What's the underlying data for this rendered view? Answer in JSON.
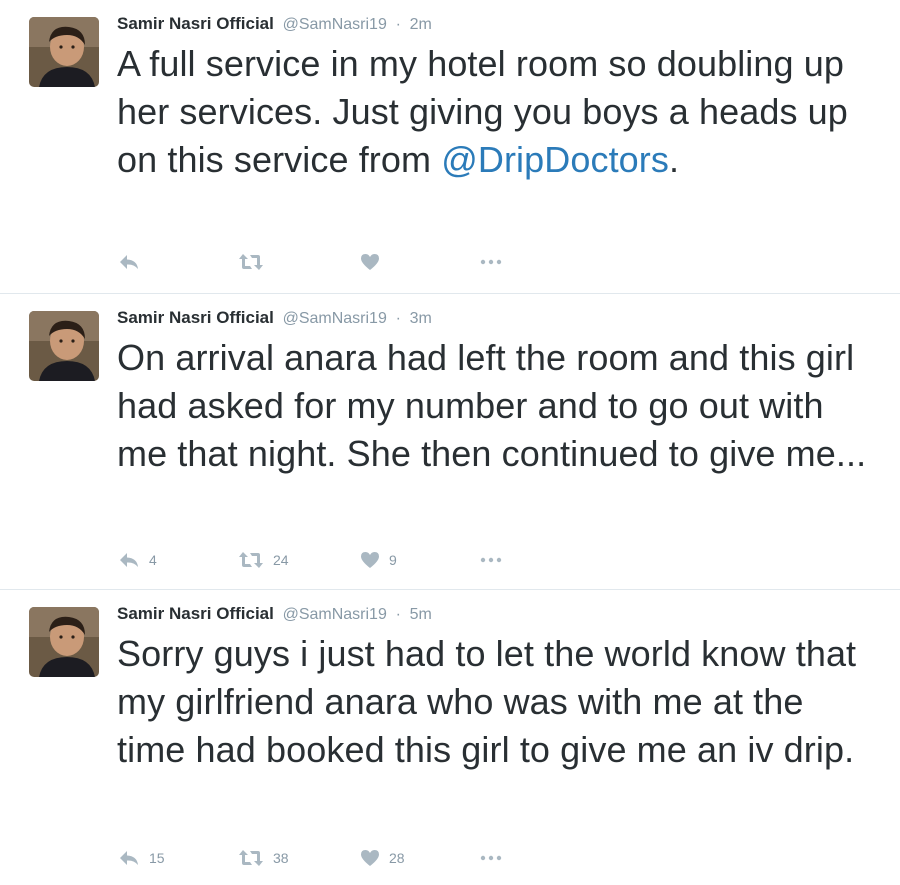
{
  "colors": {
    "text": "#292f33",
    "meta": "#8899a6",
    "icon": "#aab8c2",
    "link": "#2b7bb9",
    "divider": "#e1e8ed"
  },
  "tweets": [
    {
      "name": "Samir Nasri Official",
      "handle": "@SamNasri19",
      "separator": "·",
      "time": "2m",
      "text_before": "A full service in my hotel room so doubling up her services. Just giving you boys a heads up on this service from ",
      "mention": "@DripDoctors",
      "text_after": ".",
      "replies": "",
      "retweets": "",
      "likes": ""
    },
    {
      "name": "Samir Nasri Official",
      "handle": "@SamNasri19",
      "separator": "·",
      "time": "3m",
      "text_before": "On arrival anara had left the room and this girl had asked for my number and to go out with me that night. She then continued to give me...",
      "mention": "",
      "text_after": "",
      "replies": "4",
      "retweets": "24",
      "likes": "9"
    },
    {
      "name": "Samir Nasri Official",
      "handle": "@SamNasri19",
      "separator": "·",
      "time": "5m",
      "text_before": "Sorry guys i just had to let the world know that my girlfriend anara who was with me at the time had booked this girl to give me an iv drip.",
      "mention": "",
      "text_after": "",
      "replies": "15",
      "retweets": "38",
      "likes": "28"
    }
  ],
  "icons": {
    "reply": "reply-icon",
    "retweet": "retweet-icon",
    "like": "heart-icon",
    "more": "more-dots-icon",
    "avatar": "profile-photo"
  }
}
